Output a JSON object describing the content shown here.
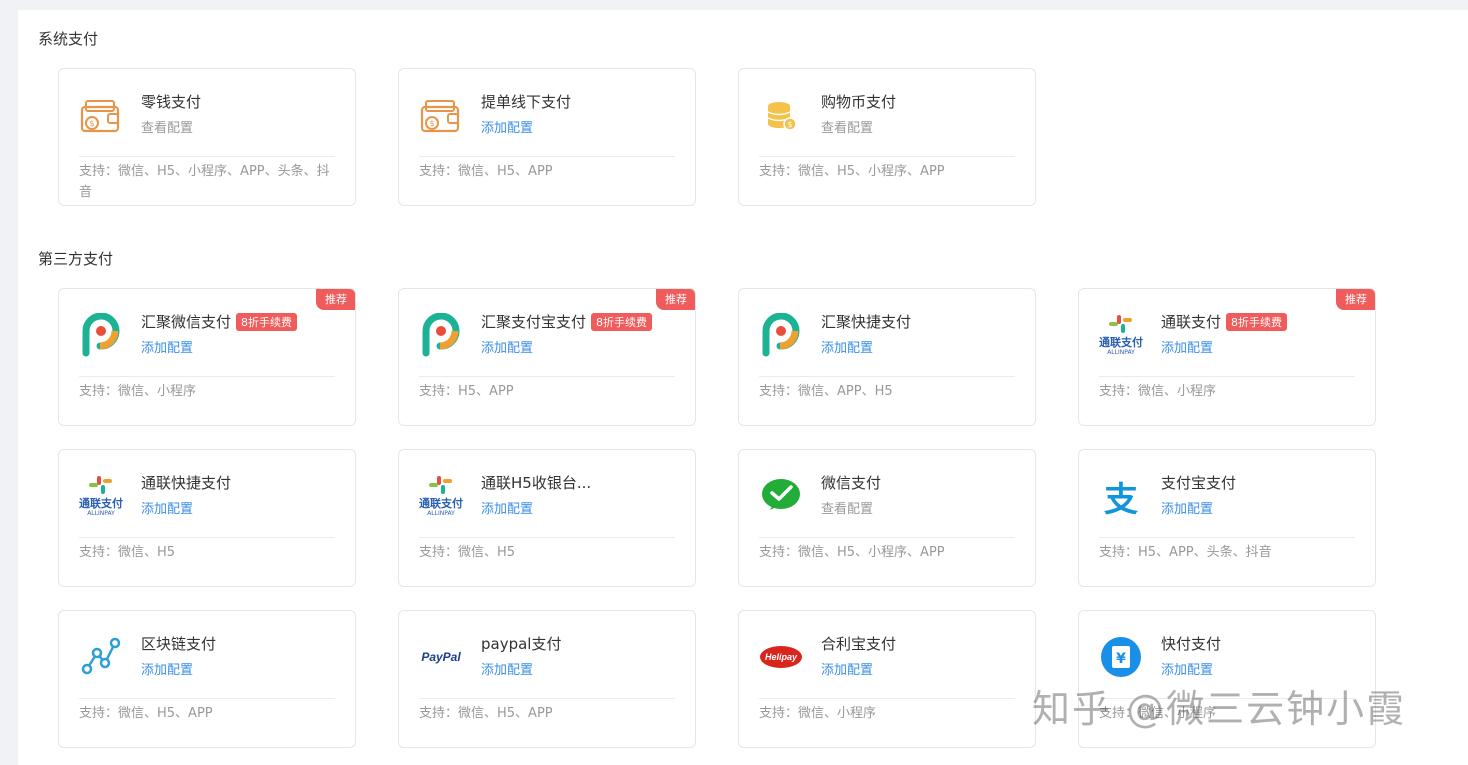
{
  "sections": {
    "system": {
      "title": "系统支付",
      "cards": [
        {
          "name": "零钱支付",
          "config": "查看配置",
          "support": "支持：微信、H5、小程序、APP、头条、抖音"
        },
        {
          "name": "提单线下支付",
          "config": "添加配置",
          "support": "支持：微信、H5、APP"
        },
        {
          "name": "购物币支付",
          "config": "查看配置",
          "support": "支持：微信、H5、小程序、APP"
        }
      ]
    },
    "third": {
      "title": "第三方支付",
      "cards": [
        {
          "name": "汇聚微信支付",
          "badge": "8折手续费",
          "recommend": "推荐",
          "config": "添加配置",
          "support": "支持：微信、小程序"
        },
        {
          "name": "汇聚支付宝支付",
          "badge": "8折手续费",
          "recommend": "推荐",
          "config": "添加配置",
          "support": "支持：H5、APP"
        },
        {
          "name": "汇聚快捷支付",
          "config": "添加配置",
          "support": "支持：微信、APP、H5"
        },
        {
          "name": "通联支付",
          "badge": "8折手续费",
          "recommend": "推荐",
          "config": "添加配置",
          "support": "支持：微信、小程序"
        },
        {
          "name": "通联快捷支付",
          "config": "添加配置",
          "support": "支持：微信、H5"
        },
        {
          "name": "通联H5收银台...",
          "config": "添加配置",
          "support": "支持：微信、H5"
        },
        {
          "name": "微信支付",
          "config": "查看配置",
          "support": "支持：微信、H5、小程序、APP"
        },
        {
          "name": "支付宝支付",
          "config": "添加配置",
          "support": "支持：H5、APP、头条、抖音"
        },
        {
          "name": "区块链支付",
          "config": "添加配置",
          "support": "支持：微信、H5、APP"
        },
        {
          "name": "paypal支付",
          "config": "添加配置",
          "support": "支持：微信、H5、APP"
        },
        {
          "name": "合利宝支付",
          "config": "添加配置",
          "support": "支持：微信、小程序"
        },
        {
          "name": "快付支付",
          "config": "添加配置",
          "support": "支持：微信、小程序"
        }
      ]
    }
  },
  "logos": {
    "allinpay": "ALLINPAY",
    "paypal": "PayPal",
    "helipay": "Helipay",
    "kuaifu": "¥",
    "alipay": "支"
  },
  "watermark": "知乎 @微三云钟小霞",
  "colors": {
    "accent": "#3b8fe6",
    "badge": "#f05b5b"
  }
}
